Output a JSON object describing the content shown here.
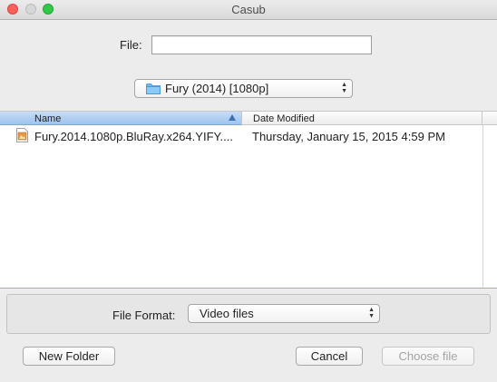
{
  "window": {
    "title": "Casub",
    "controls": [
      "close",
      "minimize",
      "zoom"
    ]
  },
  "file_field": {
    "label": "File:",
    "value": "",
    "placeholder": ""
  },
  "location": {
    "folder_name": "Fury (2014) [1080p]",
    "icon": "folder-icon"
  },
  "file_list": {
    "columns": [
      {
        "label": "Name",
        "sorted": "ascending"
      },
      {
        "label": "Date Modified"
      }
    ],
    "rows": [
      {
        "name": "Fury.2014.1080p.BluRay.x264.YIFY....",
        "date_modified": "Thursday, January 15, 2015 4:59 PM",
        "icon": "video-file-icon"
      }
    ]
  },
  "format": {
    "label": "File Format:",
    "selected": "Video files"
  },
  "buttons": {
    "new_folder": "New Folder",
    "cancel": "Cancel",
    "choose": "Choose file"
  },
  "colors": {
    "selected_header": "#9ec3ee",
    "close": "#fc605c",
    "zoom": "#34c84a",
    "disabled_text": "#a3a3a3"
  }
}
